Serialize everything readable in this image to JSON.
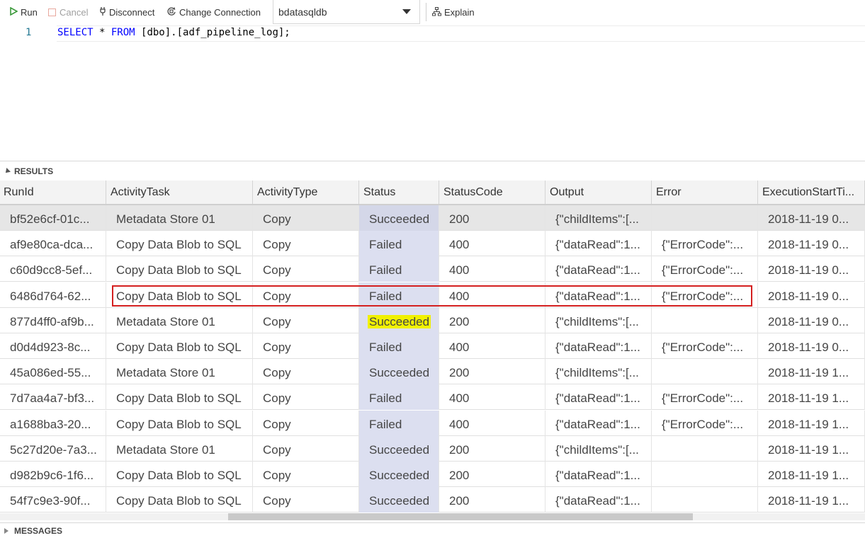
{
  "toolbar": {
    "run_label": "Run",
    "cancel_label": "Cancel",
    "disconnect_label": "Disconnect",
    "change_connection_label": "Change Connection",
    "database": "bdatasqldb",
    "explain_label": "Explain"
  },
  "editor": {
    "line_number": "1",
    "code_keyword_select": "SELECT",
    "code_star": " * ",
    "code_keyword_from": "FROM",
    "code_rest": " [dbo].[adf_pipeline_log];"
  },
  "results": {
    "section_label": "RESULTS",
    "columns": [
      "RunId",
      "ActivityTask",
      "ActivityType",
      "Status",
      "StatusCode",
      "Output",
      "Error",
      "ExecutionStartTi..."
    ],
    "rows": [
      [
        "bf52e6cf-01c...",
        "Metadata Store 01",
        "Copy",
        "Succeeded",
        "200",
        "{\"childItems\":[...",
        "",
        "2018-11-19 0..."
      ],
      [
        "af9e80ca-dca...",
        "Copy Data Blob to SQL",
        "Copy",
        "Failed",
        "400",
        "{\"dataRead\":1...",
        "{\"ErrorCode\":...",
        "2018-11-19 0..."
      ],
      [
        "c60d9cc8-5ef...",
        "Copy Data Blob to SQL",
        "Copy",
        "Failed",
        "400",
        "{\"dataRead\":1...",
        "{\"ErrorCode\":...",
        "2018-11-19 0..."
      ],
      [
        "6486d764-62...",
        "Copy Data Blob to SQL",
        "Copy",
        "Failed",
        "400",
        "{\"dataRead\":1...",
        "{\"ErrorCode\":...",
        "2018-11-19 0..."
      ],
      [
        "877d4ff0-af9b...",
        "Metadata Store 01",
        "Copy",
        "Succeeded",
        "200",
        "{\"childItems\":[...",
        "",
        "2018-11-19 0..."
      ],
      [
        "d0d4d923-8c...",
        "Copy Data Blob to SQL",
        "Copy",
        "Failed",
        "400",
        "{\"dataRead\":1...",
        "{\"ErrorCode\":...",
        "2018-11-19 0..."
      ],
      [
        "45a086ed-55...",
        "Metadata Store 01",
        "Copy",
        "Succeeded",
        "200",
        "{\"childItems\":[...",
        "",
        "2018-11-19 1..."
      ],
      [
        "7d7aa4a7-bf3...",
        "Copy Data Blob to SQL",
        "Copy",
        "Failed",
        "400",
        "{\"dataRead\":1...",
        "{\"ErrorCode\":...",
        "2018-11-19 1..."
      ],
      [
        "a1688ba3-20...",
        "Copy Data Blob to SQL",
        "Copy",
        "Failed",
        "400",
        "{\"dataRead\":1...",
        "{\"ErrorCode\":...",
        "2018-11-19 1..."
      ],
      [
        "5c27d20e-7a3...",
        "Metadata Store 01",
        "Copy",
        "Succeeded",
        "200",
        "{\"childItems\":[...",
        "",
        "2018-11-19 1..."
      ],
      [
        "d982b9c6-1f6...",
        "Copy Data Blob to SQL",
        "Copy",
        "Succeeded",
        "200",
        "{\"dataRead\":1...",
        "",
        "2018-11-19 1..."
      ],
      [
        "54f7c9e3-90f...",
        "Copy Data Blob to SQL",
        "Copy",
        "Succeeded",
        "200",
        "{\"dataRead\":1...",
        "",
        "2018-11-19 1..."
      ]
    ],
    "selected_row": 0,
    "boxed_row": 3,
    "highlighted_row": 4
  },
  "messages": {
    "section_label": "MESSAGES"
  },
  "colors": {
    "status_column_bg": "#dcdff0",
    "highlight_yellow": "#f1f100",
    "annotation_red": "#d42020",
    "run_green": "#3c9a3c"
  }
}
